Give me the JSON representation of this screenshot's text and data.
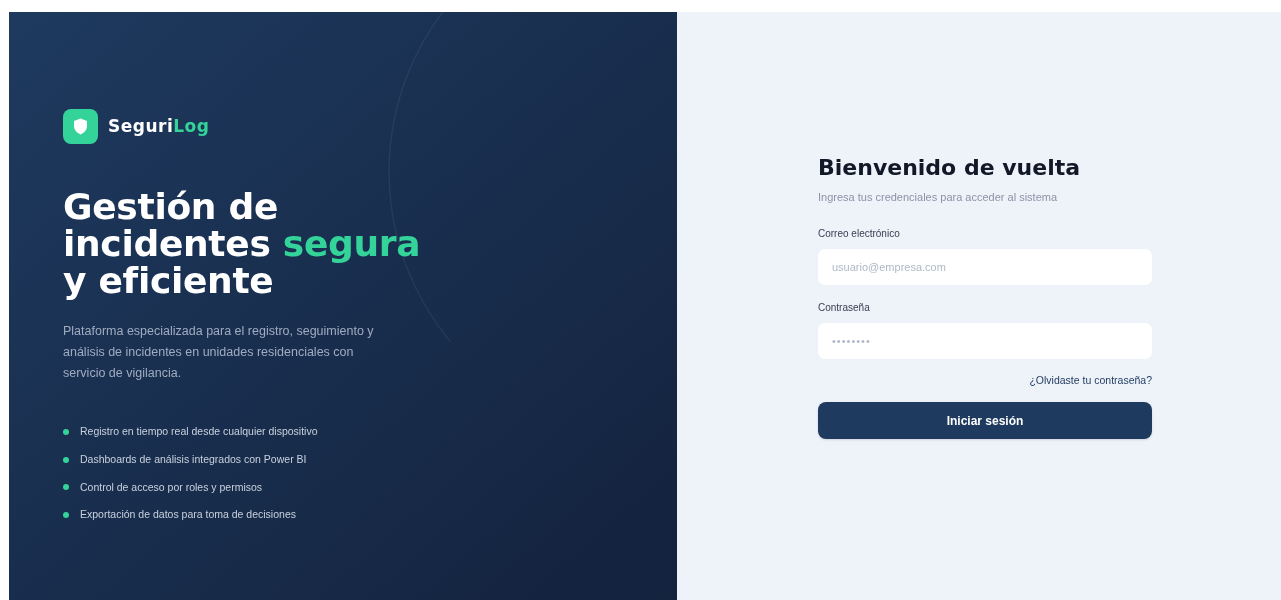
{
  "brand": {
    "parts": [
      {
        "text": "Seguri",
        "accent": false
      },
      {
        "text": "Log",
        "accent": true
      }
    ]
  },
  "hero": {
    "headline": [
      {
        "text": "Gestión de incidentes ",
        "accent": false
      },
      {
        "text": "segura",
        "accent": true
      },
      {
        "text": " y eficiente",
        "accent": false
      }
    ],
    "description": "Plataforma especializada para el registro, seguimiento y análisis de incidentes en unidades residenciales con servicio de vigilancia.",
    "features": [
      "Registro en tiempo real desde cualquier dispositivo",
      "Dashboards de análisis integrados con Power BI",
      "Control de acceso por roles y permisos",
      "Exportación de datos para toma de decisiones"
    ]
  },
  "login": {
    "title": "Bienvenido de vuelta",
    "subtitle": "Ingresa tus credenciales para acceder al sistema",
    "fields": [
      {
        "label": "Correo electrónico",
        "placeholder": "usuario@empresa.com",
        "kind": "email"
      },
      {
        "label": "Contraseña",
        "placeholder": "••••••••",
        "kind": "password"
      }
    ],
    "forgot_link": "¿Olvidaste tu contraseña?",
    "submit": "Iniciar sesión"
  }
}
